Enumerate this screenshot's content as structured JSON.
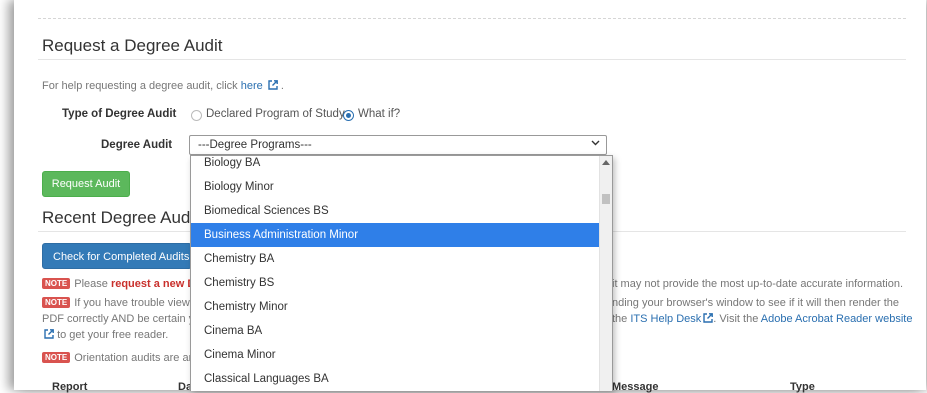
{
  "page": {
    "section_title": "Request a Degree Audit",
    "help_prefix": "For help requesting a degree audit, click",
    "help_link": "here",
    "type_label": "Type of Degree Audit",
    "radio_declared": "Declared Program of Study",
    "radio_whatif": "What if?",
    "degree_audit_label": "Degree Audit",
    "select_value": "---Degree Programs---",
    "request_button": "Request Audit",
    "recent_title": "Recent Degree Audits",
    "check_button": "Check for Completed Audits"
  },
  "notes": {
    "badge": "NOTE",
    "n1_prefix": "Please",
    "n1_strong": "request a new D",
    "n1_tail": "it may not provide the most up-to-date accurate information.",
    "n2_prefix": "If you have trouble viewi",
    "n2_mid": "nding your browser's window to see if it will then render the",
    "n2_line2_a": "PDF correctly AND be certain y",
    "n2_line2_b": "the",
    "n2_link1": "ITS Help Desk",
    "n2_line2_c": ". Visit the",
    "n2_link2": "Adobe Acrobat Reader website",
    "n2_line3": "to get your free reader.",
    "n3": "Orientation audits are an"
  },
  "table_headers": {
    "report": "Report",
    "date": "Da",
    "message": "Message",
    "type": "Type"
  },
  "dropdown": {
    "options": [
      "Biology BA",
      "Biology Minor",
      "Biomedical Sciences BS",
      "Business Administration Minor",
      "Chemistry BA",
      "Chemistry BS",
      "Chemistry Minor",
      "Cinema BA",
      "Cinema Minor",
      "Classical Languages BA"
    ],
    "selected": "Business Administration Minor"
  },
  "colors": {
    "accent": "#337ab7",
    "success": "#5cb85c",
    "selected_option": "#2f7fe8",
    "note_badge": "#d9534f"
  }
}
